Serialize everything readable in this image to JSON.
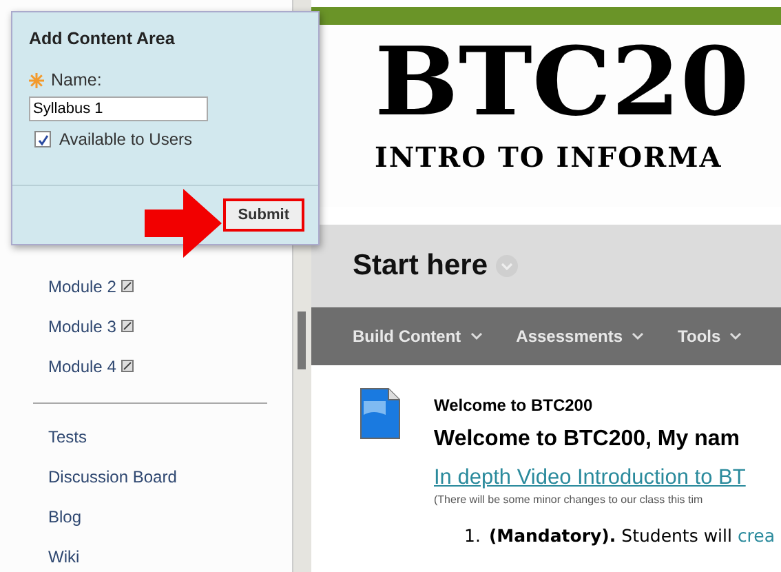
{
  "dialog": {
    "title": "Add Content Area",
    "name_label": "Name:",
    "name_value": "Syllabus 1",
    "available": {
      "label": "Available to Users",
      "checked": true
    },
    "submit": "Submit"
  },
  "sidebar": {
    "modules": [
      {
        "label": "Module 2"
      },
      {
        "label": "Module 3"
      },
      {
        "label": "Module 4"
      }
    ],
    "tools": [
      "Tests",
      "Discussion Board",
      "Blog",
      "Wiki"
    ]
  },
  "course_logo": {
    "title": "BTC20",
    "subtitle": "INTRO TO INFORMA"
  },
  "page_title": "Start here",
  "toolbar": [
    "Build Content",
    "Assessments",
    "Tools"
  ],
  "item": {
    "title": "Welcome to BTC200",
    "heading": "Welcome to BTC200, My nam",
    "link": "In depth Video Introduction to BT",
    "note": "(There will be some minor changes to our class this tim",
    "list": [
      {
        "number": "1.",
        "text": "**(Mandatory).** Students will ",
        "link": "crea"
      }
    ]
  }
}
